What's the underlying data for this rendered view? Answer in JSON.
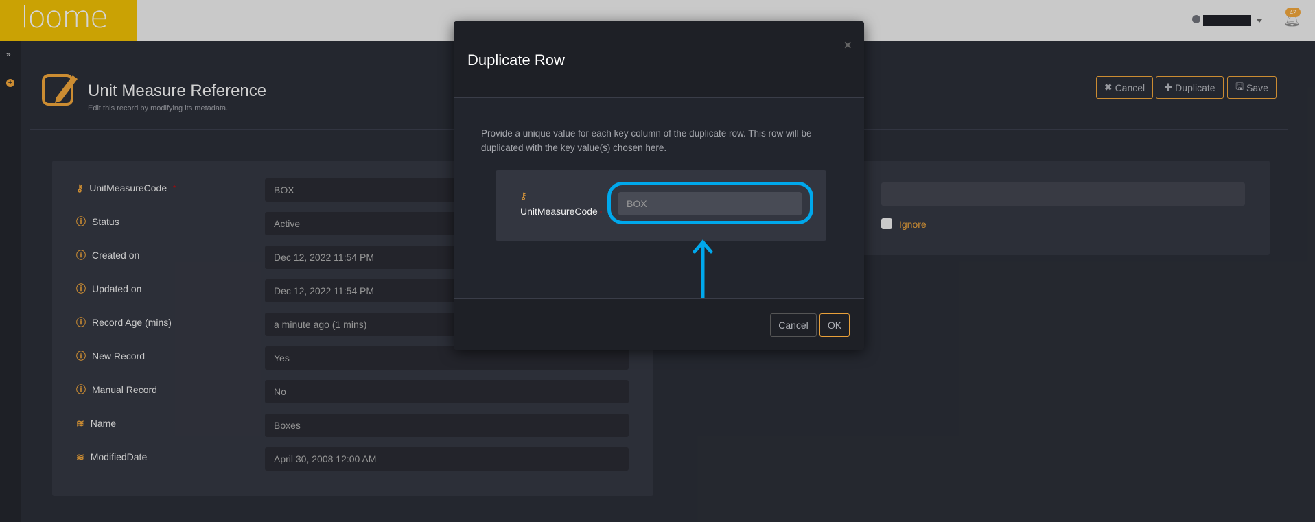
{
  "header": {
    "logo": "loome",
    "notifications_count": "42"
  },
  "page": {
    "title": "Unit Measure Reference",
    "subtitle": "Edit this record by modifying its metadata.",
    "actions": {
      "cancel": "Cancel",
      "duplicate": "Duplicate",
      "save": "Save"
    }
  },
  "fields": [
    {
      "label": "UnitMeasureCode",
      "icon": "key-icon",
      "required": true,
      "value": "BOX"
    },
    {
      "label": "Status",
      "icon": "info-icon",
      "value": "Active"
    },
    {
      "label": "Created on",
      "icon": "info-icon",
      "value": "Dec 12, 2022 11:54 PM"
    },
    {
      "label": "Updated on",
      "icon": "info-icon",
      "value": "Dec 12, 2022 11:54 PM"
    },
    {
      "label": "Record Age (mins)",
      "icon": "info-icon",
      "value": "a minute ago (1 mins)"
    },
    {
      "label": "New Record",
      "icon": "info-icon",
      "value": "Yes"
    },
    {
      "label": "Manual Record",
      "icon": "info-icon",
      "value": "No"
    },
    {
      "label": "Name",
      "icon": "database-icon",
      "value": "Boxes"
    },
    {
      "label": "ModifiedDate",
      "icon": "database-icon",
      "value": "April 30, 2008 12:00 AM"
    }
  ],
  "right_panel": {
    "input_value": "",
    "ignore_label": "Ignore",
    "ignore_checked": false
  },
  "modal": {
    "title": "Duplicate Row",
    "description": "Provide a unique value for each key column of the duplicate row. This row will be duplicated with the key value(s) chosen here.",
    "key_label": "UnitMeasureCode",
    "key_value": "BOX",
    "cancel": "Cancel",
    "ok": "OK"
  },
  "colors": {
    "accent": "#e8a03a",
    "highlight": "#00a8ec",
    "logo_bg": "#e6b905"
  }
}
